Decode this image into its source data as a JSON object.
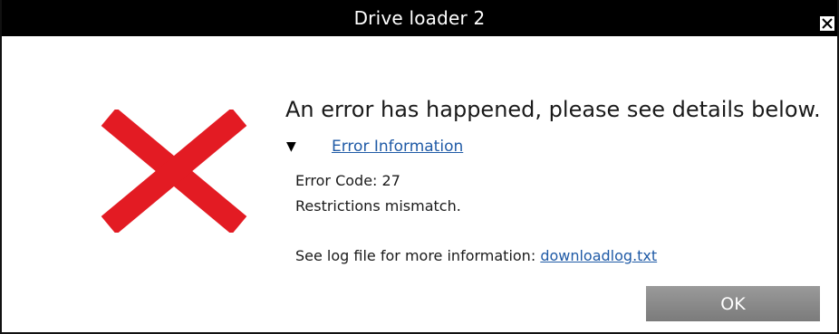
{
  "window": {
    "title": "Drive loader 2",
    "close_icon": "close-icon"
  },
  "error_icon": {
    "icon": "error-x-icon",
    "color": "#e31b23"
  },
  "message": {
    "headline": "An error has happened, please see details below."
  },
  "details": {
    "toggle_icon": "triangle-down-icon",
    "toggle_label": "Error Information",
    "code_line": "Error Code: 27",
    "description": "Restrictions mismatch.",
    "log_prefix": "See log file for more information:",
    "log_link": "downloadlog.txt"
  },
  "buttons": {
    "ok_label": "OK"
  },
  "colors": {
    "titlebar": "#000000",
    "link": "#1f5aa6",
    "ok_button": "#8a8a8a"
  }
}
